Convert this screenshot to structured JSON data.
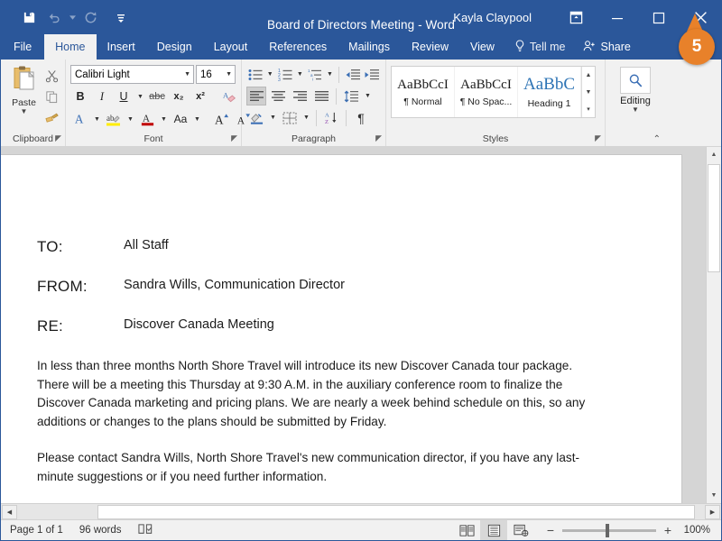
{
  "titlebar": {
    "document_title": "Board of Directors Meeting  -  Word",
    "user_name": "Kayla Claypool",
    "quick_access": [
      {
        "name": "save-icon",
        "label": "Save"
      },
      {
        "name": "undo-icon",
        "label": "Undo"
      },
      {
        "name": "redo-icon",
        "label": "Redo"
      },
      {
        "name": "customize-qat-icon",
        "label": "Customize Quick Access Toolbar"
      }
    ],
    "window_controls": [
      {
        "name": "ribbon-display-options-icon",
        "label": "Ribbon Display Options"
      },
      {
        "name": "minimize-icon",
        "label": "Minimize"
      },
      {
        "name": "maximize-icon",
        "label": "Restore Down"
      },
      {
        "name": "close-icon",
        "label": "Close"
      }
    ],
    "callout_number": "5"
  },
  "tabs": [
    {
      "label": "File",
      "active": false
    },
    {
      "label": "Home",
      "active": true
    },
    {
      "label": "Insert",
      "active": false
    },
    {
      "label": "Design",
      "active": false
    },
    {
      "label": "Layout",
      "active": false
    },
    {
      "label": "References",
      "active": false
    },
    {
      "label": "Mailings",
      "active": false
    },
    {
      "label": "Review",
      "active": false
    },
    {
      "label": "View",
      "active": false
    }
  ],
  "tellme": "Tell me",
  "share": "Share",
  "ribbon": {
    "clipboard": {
      "label": "Clipboard",
      "paste_label": "Paste",
      "cut_label": "Cut",
      "copy_label": "Copy",
      "format_painter_label": "Format Painter"
    },
    "font": {
      "label": "Font",
      "font_name": "Calibri Light",
      "font_size": "16",
      "bold": "B",
      "italic": "I",
      "underline": "U",
      "strikethrough": "abc",
      "subscript": "x₂",
      "superscript": "x²",
      "clear_formatting": "Clear All Formatting",
      "text_effects": "A",
      "highlight": "ab",
      "font_color": "A",
      "change_case": "Aa",
      "grow_font": "A",
      "shrink_font": "A"
    },
    "paragraph": {
      "label": "Paragraph",
      "bullets": "Bullets",
      "numbering": "Numbering",
      "multilevel": "Multilevel List",
      "decrease_indent": "Decrease Indent",
      "increase_indent": "Increase Indent",
      "align_left": "Align Left",
      "align_center": "Center",
      "align_right": "Align Right",
      "justify": "Justify",
      "line_spacing": "Line and Paragraph Spacing",
      "shading": "Shading",
      "borders": "Borders",
      "sort": "Sort",
      "show_marks": "¶"
    },
    "styles": {
      "label": "Styles",
      "items": [
        {
          "preview": "AaBbCcI",
          "name": "¶ Normal"
        },
        {
          "preview": "AaBbCcI",
          "name": "¶ No Spac..."
        },
        {
          "preview": "AaBbC",
          "name": "Heading 1"
        }
      ]
    },
    "editing": {
      "label": "Editing",
      "find_label": "Find"
    },
    "collapse_label": "Collapse the Ribbon"
  },
  "document": {
    "memo": [
      {
        "key": "TO:",
        "value": "All Staff"
      },
      {
        "key": "FROM:",
        "value": "Sandra Wills, Communication Director"
      },
      {
        "key": "RE:",
        "value": "Discover Canada Meeting"
      }
    ],
    "paragraphs": [
      "In less than three months North Shore Travel will introduce its new Discover Canada tour package. There will be a meeting this Thursday at 9:30 A.M. in the auxiliary conference room to finalize the Discover Canada marketing and pricing plans. We are nearly a week behind schedule on this, so any additions or changes to the plans should be submitted by Friday.",
      "Please contact Sandra Wills, North Shore Travel's new communication director, if you have any last-minute suggestions or if you need further information."
    ]
  },
  "statusbar": {
    "page_info": "Page 1 of 1",
    "word_count": "96 words",
    "proofing_label": "Proofing errors",
    "views": [
      {
        "name": "read-mode-icon",
        "label": "Read Mode",
        "active": false
      },
      {
        "name": "print-layout-icon",
        "label": "Print Layout",
        "active": true
      },
      {
        "name": "web-layout-icon",
        "label": "Web Layout",
        "active": false
      }
    ],
    "zoom_out": "−",
    "zoom_in": "+",
    "zoom_level": "100%"
  },
  "colors": {
    "word_blue": "#2b579a",
    "ribbon_bg": "#f1f1f1",
    "callout_orange": "#e8812a",
    "heading_blue": "#2e74b5"
  }
}
